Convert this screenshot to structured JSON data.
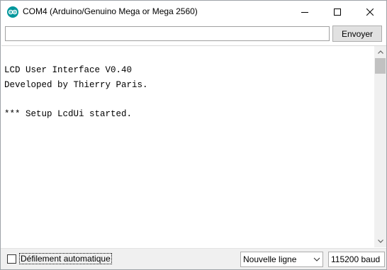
{
  "window": {
    "title": "COM4 (Arduino/Genuino Mega or Mega 2560)",
    "icon": "arduino-icon"
  },
  "controls": {
    "minimize_icon": "minimize-icon",
    "maximize_icon": "maximize-icon",
    "close_icon": "close-icon"
  },
  "send": {
    "input_value": "",
    "button_label": "Envoyer"
  },
  "output": {
    "lines": [
      "LCD User Interface V0.40",
      "Developed by Thierry Paris.",
      "",
      "*** Setup LcdUi started."
    ]
  },
  "footer": {
    "autoscroll_label": "Défilement automatique",
    "autoscroll_checked": false,
    "line_ending": "Nouvelle ligne",
    "baud_rate": "115200 baud"
  },
  "colors": {
    "arduino_teal": "#00979c",
    "bottom_bar": "#f0f0f0",
    "button_face": "#e1e1e1"
  }
}
